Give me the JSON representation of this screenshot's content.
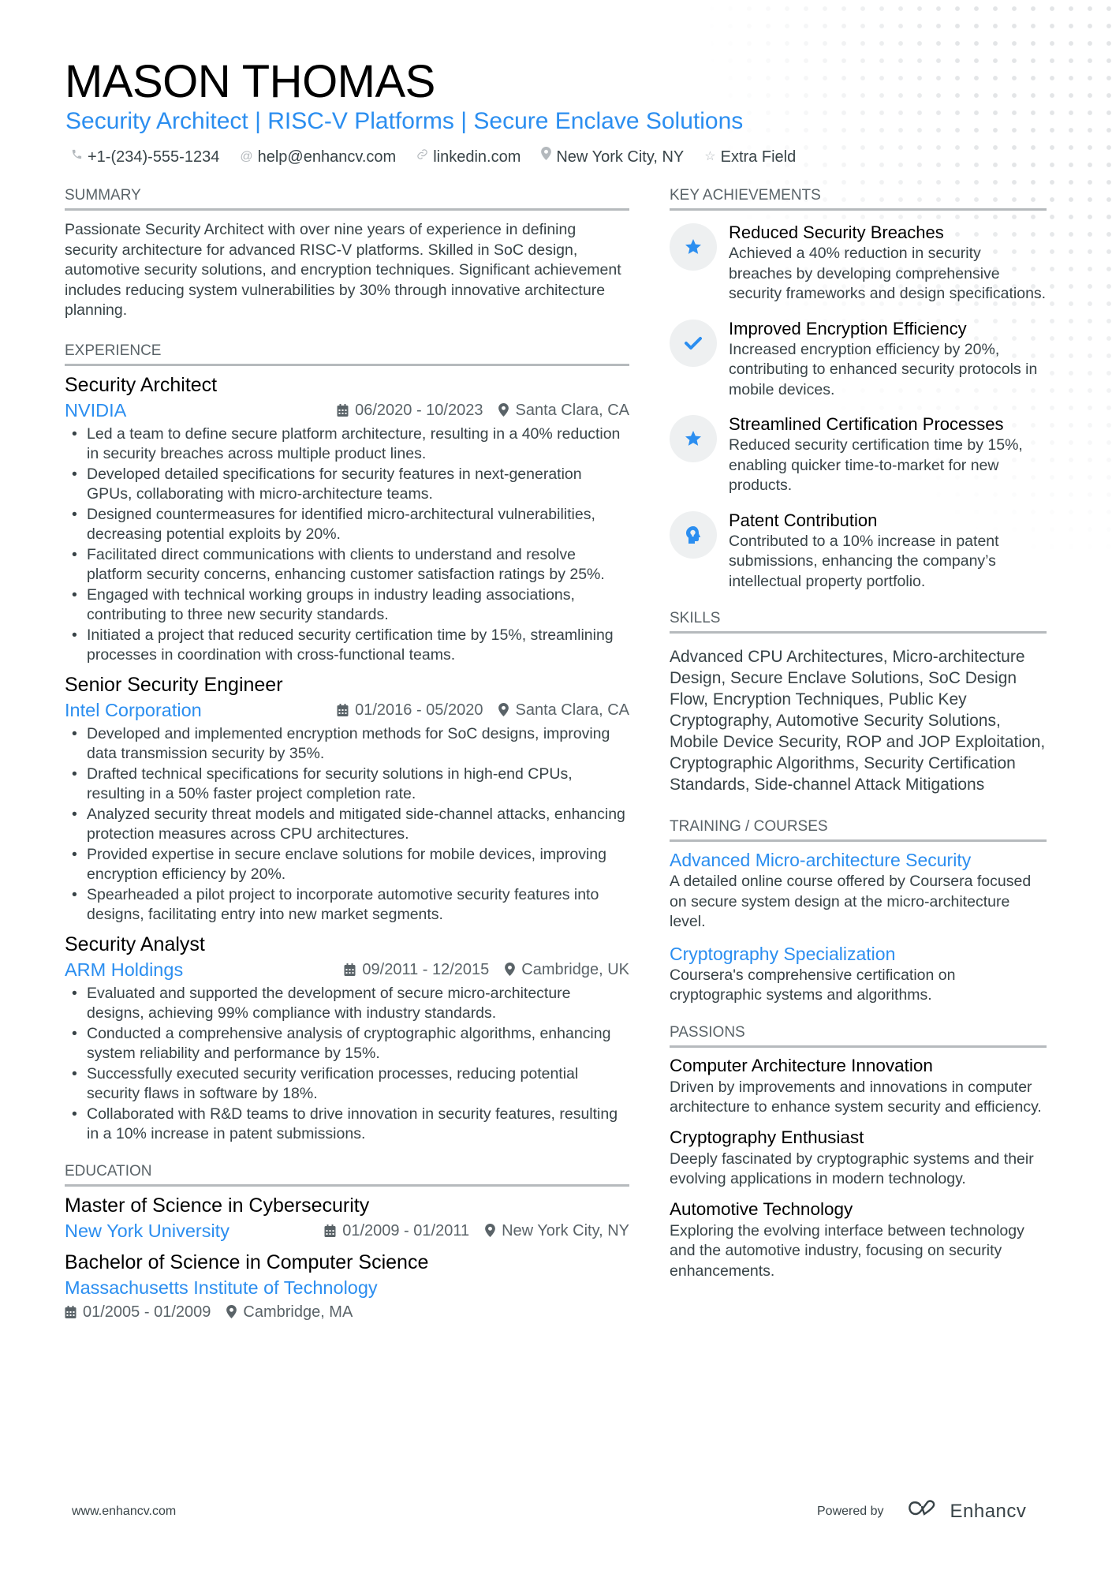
{
  "header": {
    "name": "MASON THOMAS",
    "title": "Security Architect | RISC-V Platforms | Secure Enclave Solutions",
    "contacts": [
      {
        "icon": "phone-icon",
        "text": "+1-(234)-555-1234"
      },
      {
        "icon": "at-icon",
        "text": "help@enhancv.com"
      },
      {
        "icon": "link-icon",
        "text": "linkedin.com"
      },
      {
        "icon": "location-pin-icon",
        "text": "New York City, NY"
      },
      {
        "icon": "star-outline-icon",
        "text": "Extra Field"
      }
    ]
  },
  "summary": {
    "heading": "SUMMARY",
    "text": "Passionate Security Architect with over nine years of experience in defining security architecture for advanced RISC-V platforms. Skilled in SoC design, automotive security solutions, and encryption techniques. Significant achievement includes reducing system vulnerabilities by 30% through innovative architecture planning."
  },
  "experience": {
    "heading": "EXPERIENCE",
    "jobs": [
      {
        "title": "Security Architect",
        "company": "NVIDIA",
        "dates": "06/2020 - 10/2023",
        "location": "Santa Clara, CA",
        "bullets": [
          "Led a team to define secure platform architecture, resulting in a 40% reduction in security breaches across multiple product lines.",
          "Developed detailed specifications for security features in next-generation GPUs, collaborating with micro-architecture teams.",
          "Designed countermeasures for identified micro-architectural vulnerabilities, decreasing potential exploits by 20%.",
          "Facilitated direct communications with clients to understand and resolve platform security concerns, enhancing customer satisfaction ratings by 25%.",
          "Engaged with technical working groups in industry leading associations, contributing to three new security standards.",
          "Initiated a project that reduced security certification time by 15%, streamlining processes in coordination with cross-functional teams."
        ]
      },
      {
        "title": "Senior Security Engineer",
        "company": "Intel Corporation",
        "dates": "01/2016 - 05/2020",
        "location": "Santa Clara, CA",
        "bullets": [
          "Developed and implemented encryption methods for SoC designs, improving data transmission security by 35%.",
          "Drafted technical specifications for security solutions in high-end CPUs, resulting in a 50% faster project completion rate.",
          "Analyzed security threat models and mitigated side-channel attacks, enhancing protection measures across CPU architectures.",
          "Provided expertise in secure enclave solutions for mobile devices, improving encryption efficiency by 20%.",
          "Spearheaded a pilot project to incorporate automotive security features into designs, facilitating entry into new market segments."
        ]
      },
      {
        "title": "Security Analyst",
        "company": "ARM Holdings",
        "dates": "09/2011 - 12/2015",
        "location": "Cambridge, UK",
        "bullets": [
          "Evaluated and supported the development of secure micro-architecture designs, achieving 99% compliance with industry standards.",
          "Conducted a comprehensive analysis of cryptographic algorithms, enhancing system reliability and performance by 15%.",
          "Successfully executed security verification processes, reducing potential security flaws in software by 18%.",
          "Collaborated with R&D teams to drive innovation in security features, resulting in a 10% increase in patent submissions."
        ]
      }
    ]
  },
  "education": {
    "heading": "EDUCATION",
    "items": [
      {
        "degree": "Master of Science in Cybersecurity",
        "school": "New York University",
        "dates": "01/2009 - 01/2011",
        "location": "New York City, NY"
      },
      {
        "degree": "Bachelor of Science in Computer Science",
        "school": "Massachusetts Institute of Technology",
        "dates": "01/2005 - 01/2009",
        "location": "Cambridge, MA"
      }
    ]
  },
  "achievements": {
    "heading": "KEY ACHIEVEMENTS",
    "items": [
      {
        "icon": "star-icon",
        "title": "Reduced Security Breaches",
        "desc": "Achieved a 40% reduction in security breaches by developing comprehensive security frameworks and design specifications."
      },
      {
        "icon": "checkmark-icon",
        "title": "Improved Encryption Efficiency",
        "desc": "Increased encryption efficiency by 20%, contributing to enhanced security protocols in mobile devices."
      },
      {
        "icon": "star-icon",
        "title": "Streamlined Certification Processes",
        "desc": "Reduced security certification time by 15%, enabling quicker time-to-market for new products."
      },
      {
        "icon": "head-lightbulb-icon",
        "title": "Patent Contribution",
        "desc": "Contributed to a 10% increase in patent submissions, enhancing the company’s intellectual property portfolio."
      }
    ]
  },
  "skills": {
    "heading": "SKILLS",
    "text": "Advanced CPU Architectures, Micro-architecture Design, Secure Enclave Solutions, SoC Design Flow, Encryption Techniques, Public Key Cryptography, Automotive Security Solutions, Mobile Device Security, ROP and JOP Exploitation, Cryptographic Algorithms, Security Certification Standards, Side-channel Attack Mitigations"
  },
  "training": {
    "heading": "TRAINING / COURSES",
    "items": [
      {
        "title": "Advanced Micro-architecture Security",
        "desc": "A detailed online course offered by Coursera focused on secure system design at the micro-architecture level."
      },
      {
        "title": "Cryptography Specialization",
        "desc": "Coursera's comprehensive certification on cryptographic systems and algorithms."
      }
    ]
  },
  "passions": {
    "heading": "PASSIONS",
    "items": [
      {
        "title": "Computer Architecture Innovation",
        "desc": "Driven by improvements and innovations in computer architecture to enhance system security and efficiency."
      },
      {
        "title": "Cryptography Enthusiast",
        "desc": "Deeply fascinated by cryptographic systems and their evolving applications in modern technology."
      },
      {
        "title": "Automotive Technology",
        "desc": "Exploring the evolving interface between technology and the automotive industry, focusing on security enhancements."
      }
    ]
  },
  "footer": {
    "website": "www.enhancv.com",
    "powered_by": "Powered by",
    "brand": "Enhancv"
  },
  "colors": {
    "accent": "#2b8ef0",
    "text": "#384347",
    "heading_rule": "#b6babd",
    "icon_bg": "#eef0f1"
  }
}
